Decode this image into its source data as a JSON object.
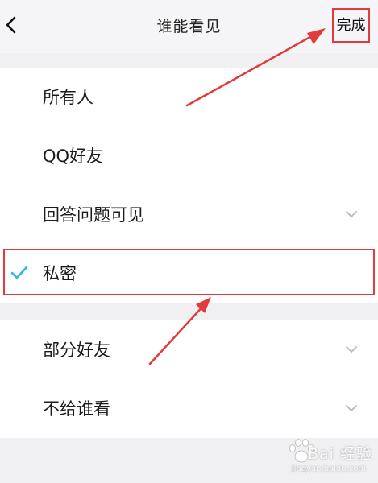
{
  "header": {
    "back_icon": "chevron-left-icon",
    "title": "谁能看见",
    "done_label": "完成"
  },
  "options": [
    {
      "label": "所有人",
      "selected": false,
      "expandable": false
    },
    {
      "label": "QQ好友",
      "selected": false,
      "expandable": false
    },
    {
      "label": "回答问题可见",
      "selected": false,
      "expandable": true
    },
    {
      "label": "私密",
      "selected": true,
      "expandable": false
    },
    {
      "label": "部分好友",
      "selected": false,
      "expandable": true
    },
    {
      "label": "不给谁看",
      "selected": false,
      "expandable": true
    }
  ],
  "watermark": {
    "brand": "Bai 经验",
    "url": "jingyan.baidu.com"
  },
  "colors": {
    "check": "#2ab8e6",
    "annotation": "#e23b3b",
    "chevron": "#b8b8bd",
    "page_background": "#f0f0f2"
  }
}
